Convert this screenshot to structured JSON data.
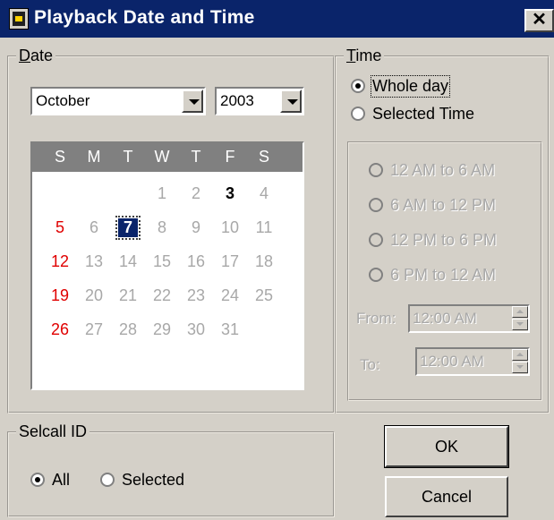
{
  "window": {
    "title": "Playback Date and Time",
    "close_glyph": "✕"
  },
  "date_group": {
    "label_accel": "D",
    "label_rest": "ate",
    "month": "October",
    "year": "2003",
    "weekday_headers": [
      "S",
      "M",
      "T",
      "W",
      "T",
      "F",
      "S"
    ],
    "days": [
      {
        "n": "1",
        "style": "muted"
      },
      {
        "n": "2",
        "style": "muted"
      },
      {
        "n": "3",
        "style": "bold"
      },
      {
        "n": "4",
        "style": "muted"
      },
      {
        "n": "5",
        "style": "sun"
      },
      {
        "n": "6",
        "style": "muted"
      },
      {
        "n": "7",
        "style": "selected"
      },
      {
        "n": "8",
        "style": "muted"
      },
      {
        "n": "9",
        "style": "muted"
      },
      {
        "n": "10",
        "style": "muted"
      },
      {
        "n": "11",
        "style": "muted"
      },
      {
        "n": "12",
        "style": "sun"
      },
      {
        "n": "13",
        "style": "muted"
      },
      {
        "n": "14",
        "style": "muted"
      },
      {
        "n": "15",
        "style": "muted"
      },
      {
        "n": "16",
        "style": "muted"
      },
      {
        "n": "17",
        "style": "muted"
      },
      {
        "n": "18",
        "style": "muted"
      },
      {
        "n": "19",
        "style": "sun"
      },
      {
        "n": "20",
        "style": "muted"
      },
      {
        "n": "21",
        "style": "muted"
      },
      {
        "n": "22",
        "style": "muted"
      },
      {
        "n": "23",
        "style": "muted"
      },
      {
        "n": "24",
        "style": "muted"
      },
      {
        "n": "25",
        "style": "muted"
      },
      {
        "n": "26",
        "style": "sun"
      },
      {
        "n": "27",
        "style": "muted"
      },
      {
        "n": "28",
        "style": "muted"
      },
      {
        "n": "29",
        "style": "muted"
      },
      {
        "n": "30",
        "style": "muted"
      },
      {
        "n": "31",
        "style": "muted"
      }
    ]
  },
  "time_group": {
    "label_accel": "T",
    "label_rest": "ime",
    "whole_day": "Whole day",
    "selected_time": "Selected Time",
    "ranges": [
      "12 AM to 6 AM",
      "6 AM to 12 PM",
      "12 PM to 6 PM",
      "6 PM to 12 AM"
    ],
    "from_label": "From:",
    "from_value": "12:00 AM",
    "to_label": "To:",
    "to_value": "12:00 AM"
  },
  "selcall_group": {
    "label": "Selcall ID",
    "all": "All",
    "selected": "Selected"
  },
  "buttons": {
    "ok": "OK",
    "cancel": "Cancel"
  },
  "colors": {
    "titlebar": "#0a246a",
    "face": "#d4d0c8",
    "sunday": "#e00000",
    "disabled": "#a8a8a8"
  },
  "icons": [
    "app-icon",
    "close-icon",
    "dropdown-arrow-icon",
    "spin-up-icon",
    "spin-down-icon",
    "radio-icon"
  ]
}
